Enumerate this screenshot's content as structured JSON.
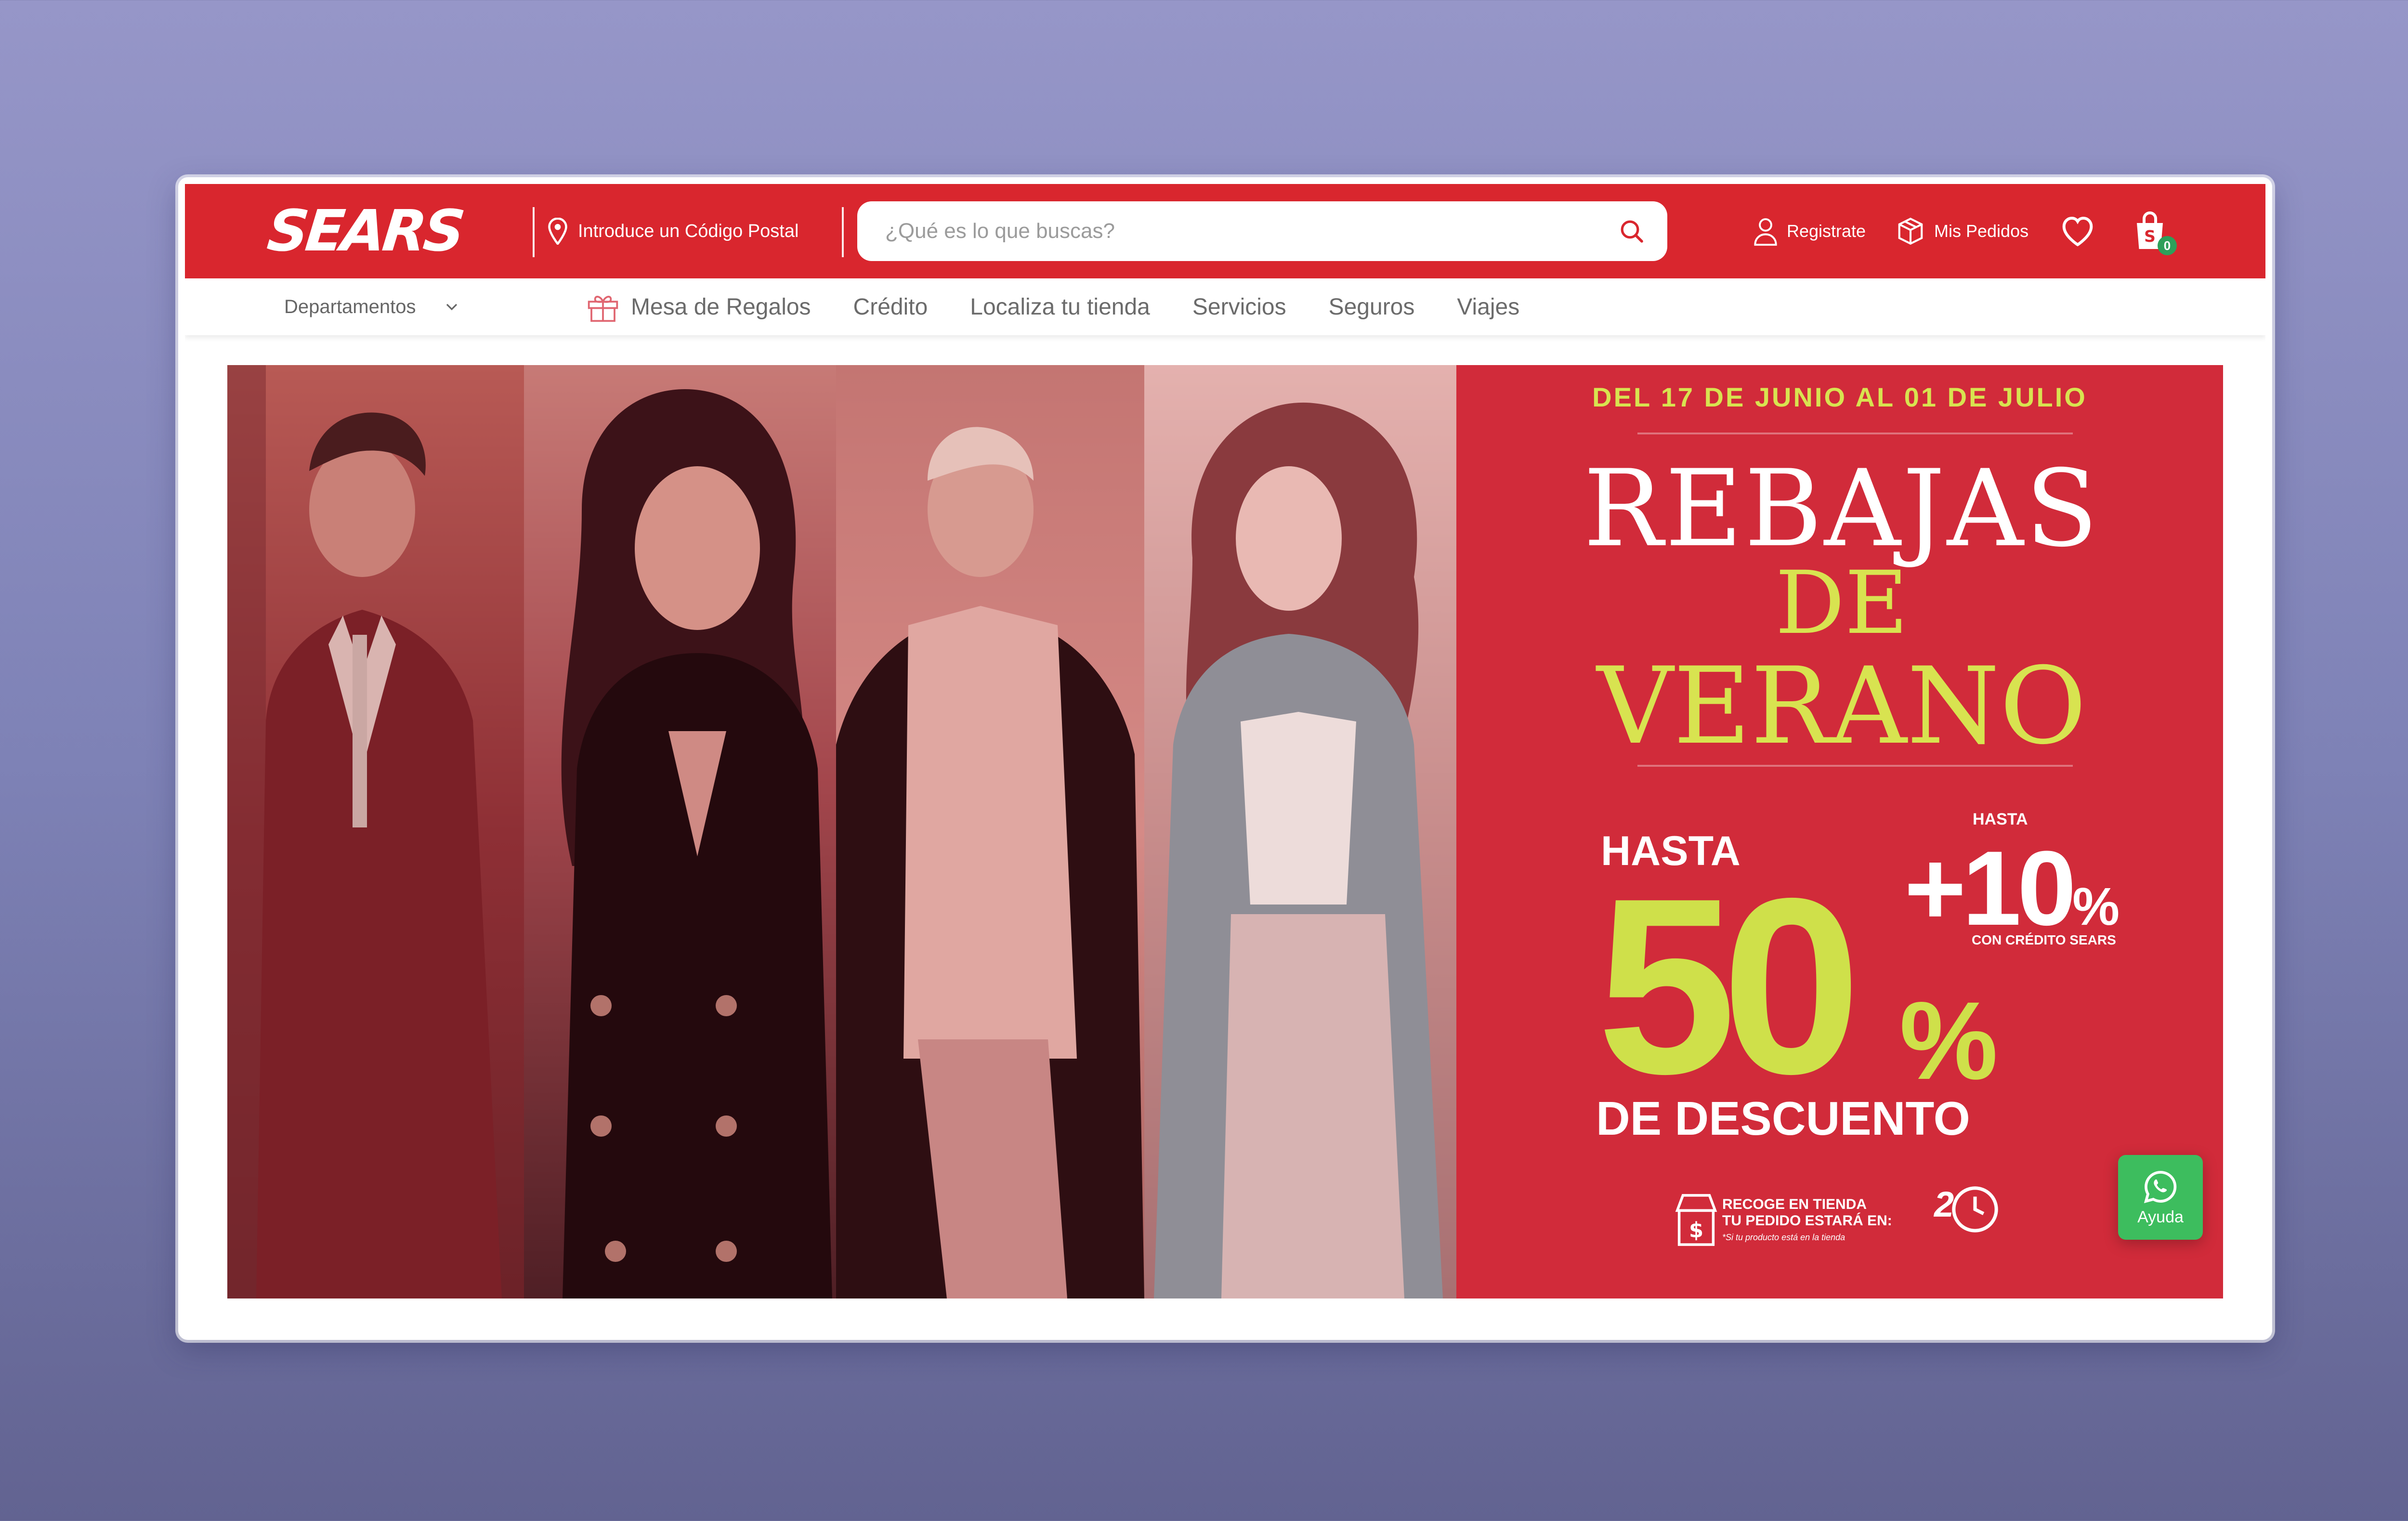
{
  "header": {
    "logo": "SEARS",
    "postal_code_prompt": "Introduce un Código Postal",
    "search_placeholder": "¿Qué es lo que buscas?",
    "register_label": "Registrate",
    "orders_label": "Mis Pedidos",
    "cart_count": "0",
    "brand_color": "#d9262e"
  },
  "nav": {
    "departments_label": "Departamentos",
    "items": [
      "Mesa de Regalos",
      "Crédito",
      "Localiza tu tienda",
      "Servicios",
      "Seguros",
      "Viajes"
    ]
  },
  "banner": {
    "dates": "DEL 17 DE JUNIO AL 01 DE JULIO",
    "title_line1": "REBAJAS",
    "title_line2": "DE",
    "title_line3": "VERANO",
    "hasta": "HASTA",
    "big_number": "50",
    "percent_sign": "%",
    "extra_hasta": "HASTA",
    "extra_plus": "+10",
    "extra_percent": "%",
    "extra_note": "CON CRÉDITO SEARS",
    "discount_label": "DE DESCUENTO",
    "pickup_line1": "RECOGE EN TIENDA",
    "pickup_line2": "TU PEDIDO ESTARÁ EN:",
    "pickup_note": "*Si tu producto está en la tienda",
    "pickup_hours": "2",
    "accent_color": "#d8e350",
    "panel_color": "#d12b3a"
  },
  "help_button": {
    "label": "Ayuda",
    "color": "#3dbd5e"
  }
}
